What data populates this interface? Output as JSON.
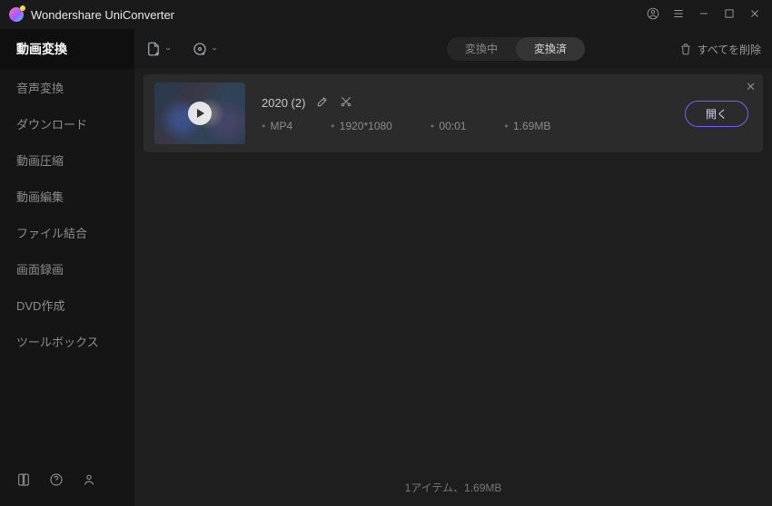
{
  "app_title": "Wondershare UniConverter",
  "sidebar": {
    "items": [
      "動画変換",
      "音声変換",
      "ダウンロード",
      "動画圧縮",
      "動画編集",
      "ファイル結合",
      "画面録画",
      "DVD作成",
      "ツールボックス"
    ],
    "active_index": 0
  },
  "toolbar": {
    "tabs": {
      "converting": "変換中",
      "converted": "変換済",
      "active": "converted"
    },
    "delete_all_label": "すべてを削除"
  },
  "item": {
    "name": "2020 (2)",
    "format": "MP4",
    "resolution": "1920*1080",
    "duration": "00:01",
    "size": "1.69MB",
    "open_label": "開く"
  },
  "status_bar": "1アイテム、1.69MB"
}
